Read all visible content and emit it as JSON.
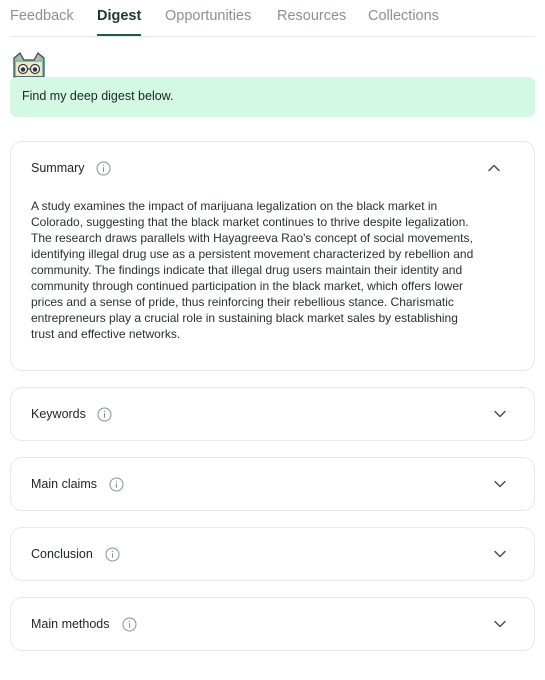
{
  "tabs": [
    {
      "label": "Feedback",
      "active": false
    },
    {
      "label": "Digest",
      "active": true
    },
    {
      "label": "Opportunities",
      "active": false
    },
    {
      "label": "Resources",
      "active": false
    },
    {
      "label": "Collections",
      "active": false
    }
  ],
  "banner": {
    "text": "Find my deep digest below."
  },
  "sections": [
    {
      "title": "Summary",
      "expanded": true,
      "body_lines": [
        "A study examines the impact of marijuana legalization on the black market in",
        "Colorado, suggesting that the black market continues to thrive despite legalization.",
        "The research draws parallels with Hayagreeva Rao's concept of social movements,",
        "identifying illegal drug use as a persistent movement characterized by rebellion and",
        "community. The findings indicate that illegal drug users maintain their identity and",
        "community through continued participation in the black market, which offers lower",
        "prices and a sense of pride, thus reinforcing their rebellious stance. Charismatic",
        "entrepreneurs play a crucial role in sustaining black market sales by establishing",
        "trust and effective networks."
      ]
    },
    {
      "title": "Keywords",
      "expanded": false
    },
    {
      "title": "Main claims",
      "expanded": false
    },
    {
      "title": "Conclusion",
      "expanded": false
    },
    {
      "title": "Main methods",
      "expanded": false
    }
  ],
  "icons": {
    "mascot": "cat-mascot-icon",
    "info": "info-circle-icon",
    "collapse": "chevron-up-icon",
    "expand": "chevron-down-icon"
  },
  "colors": {
    "accent": "#1f5c3e",
    "banner_bg": "#d3f8e3",
    "muted_text": "#8a8f98"
  }
}
